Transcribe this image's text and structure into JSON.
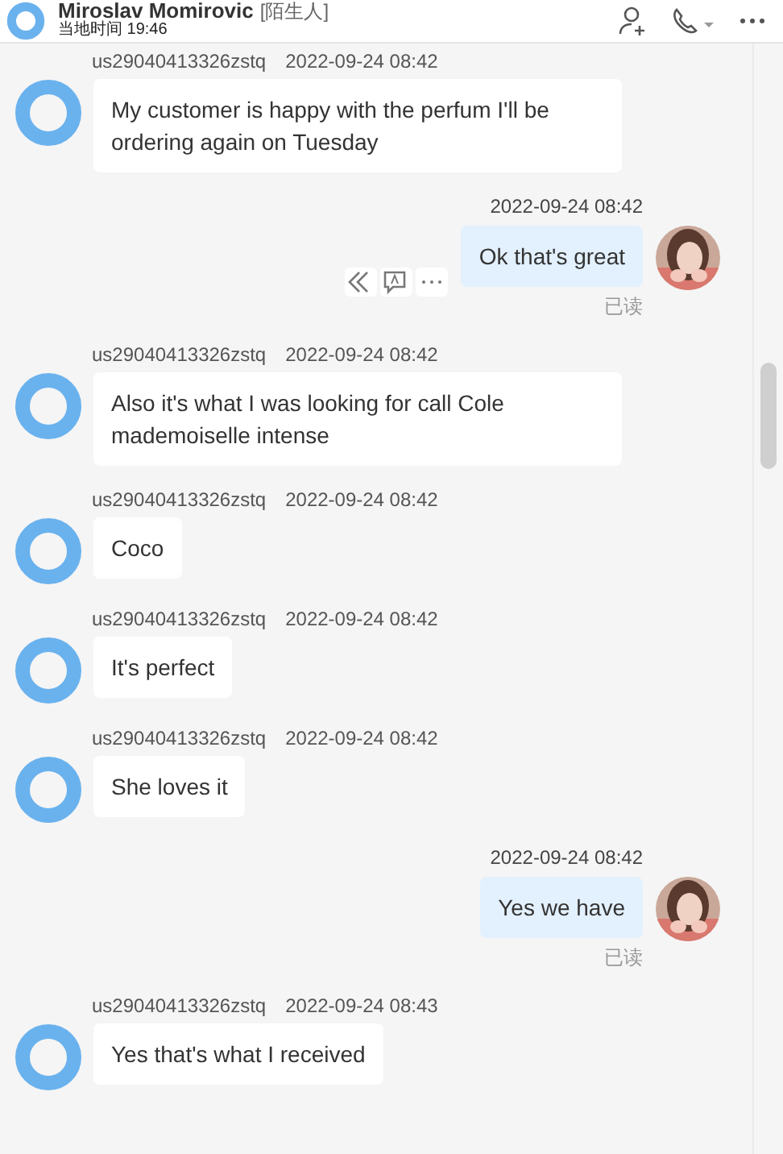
{
  "header": {
    "title": "Miroslav Momirovic",
    "tag": "[陌生人]",
    "local_time": "当地时间 19:46"
  },
  "messages": [
    {
      "kind": "incoming",
      "sender": "us29040413326zstq",
      "time": "2022-09-24 08:42",
      "text": "My customer is happy with the perfum I'll be ordering again on Tuesday"
    },
    {
      "kind": "outgoing",
      "time": "2022-09-24 08:42",
      "text": "Ok that's great",
      "status": "已读",
      "show_actions": true
    },
    {
      "kind": "incoming",
      "sender": "us29040413326zstq",
      "time": "2022-09-24 08:42",
      "text": "Also it's what I was looking for call Cole mademoiselle intense"
    },
    {
      "kind": "incoming",
      "sender": "us29040413326zstq",
      "time": "2022-09-24 08:42",
      "text": "Coco"
    },
    {
      "kind": "incoming",
      "sender": "us29040413326zstq",
      "time": "2022-09-24 08:42",
      "text": "It's perfect"
    },
    {
      "kind": "incoming",
      "sender": "us29040413326zstq",
      "time": "2022-09-24 08:42",
      "text": "She loves it"
    },
    {
      "kind": "outgoing",
      "time": "2022-09-24 08:42",
      "text": "Yes we have",
      "status": "已读",
      "show_actions": false
    },
    {
      "kind": "incoming",
      "sender": "us29040413326zstq",
      "time": "2022-09-24 08:43",
      "text": "Yes that's what I received"
    }
  ]
}
